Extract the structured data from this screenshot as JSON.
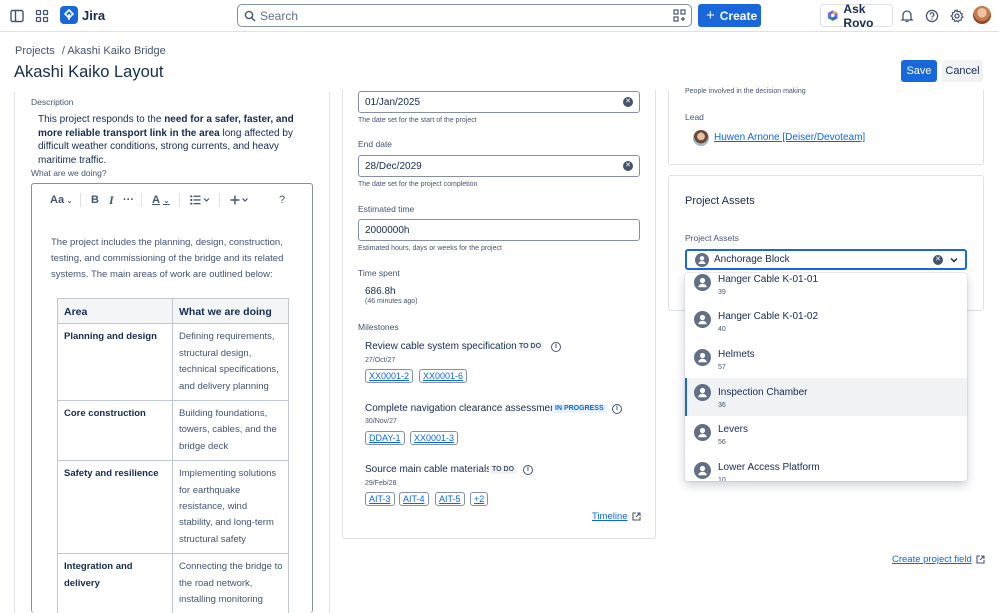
{
  "topbar": {
    "app_name": "Jira",
    "search_placeholder": "Search",
    "create_label": "Create",
    "ask_rovo_label": "Ask Rovo"
  },
  "header": {
    "breadcrumb_projects": "Projects",
    "breadcrumb_project": "/ Akashi Kaiko Bridge",
    "title": "Akashi Kaiko Layout",
    "save_label": "Save",
    "cancel_label": "Cancel"
  },
  "left": {
    "description_label": "Description",
    "description_pre": "This project responds to the ",
    "description_bold": "need for a safer, faster, and more reliable transport link in the area",
    "description_post": " long affected by difficult weather conditions, strong currents, and heavy maritime traffic.",
    "what_label": "What are we doing?",
    "toolbar": {
      "text_style": "Aa",
      "bold": "B",
      "italic": "I",
      "more": "···",
      "color": "A",
      "help": "?"
    },
    "paragraph": "The project includes the planning, design, construction, testing, and commissioning of the bridge and its related systems. The main areas of work are outlined below:",
    "table_headers": [
      "Area",
      "What we are doing"
    ],
    "table_rows": [
      {
        "area": "Planning and design",
        "doing": "Defining requirements, structural design, technical specifications, and delivery planning"
      },
      {
        "area": "Core construction",
        "doing": "Building foundations, towers, cables, and the bridge deck"
      },
      {
        "area": "Safety and resilience",
        "doing": "Implementing solutions for earthquake resistance, wind stability, and long-term structural safety"
      },
      {
        "area": "Integration and delivery",
        "doing": "Connecting the bridge to the road network, installing monitoring"
      }
    ]
  },
  "middle": {
    "start_date_value": "01/Jan/2025",
    "start_date_helper": "The date set for the start of the project",
    "end_date_label": "End date",
    "end_date_value": "28/Dec/2029",
    "end_date_helper": "The date set for the project completion",
    "estimated_label": "Estimated time",
    "estimated_value": "2000000h",
    "estimated_helper": "Estimated hours, days or weeks for the project",
    "time_spent_label": "Time spent",
    "time_spent_value": "686.8h",
    "time_spent_sub": "(46 minutes ago)",
    "milestones_label": "Milestones",
    "milestones": [
      {
        "name": "Review cable system specifications",
        "status": "TO DO",
        "date": "27/Oct/27",
        "items": [
          "XX0001-2",
          "XX0001-6"
        ]
      },
      {
        "name": "Complete navigation clearance assessment",
        "status": "IN PROGRESS",
        "date": "30/Nov/27",
        "items": [
          "DDAY-1",
          "XX0001-3"
        ]
      },
      {
        "name": "Source main cable materials",
        "status": "TO DO",
        "date": "29/Feb/28",
        "items": [
          "AIT-3",
          "AIT-4",
          "AIT-5",
          "+2"
        ]
      }
    ],
    "timeline_link": "Timeline"
  },
  "right": {
    "people_helper": "People involved in the decision making",
    "lead_label": "Lead",
    "lead_name": "Huwen Arnone [Deiser/Devoteam]",
    "assets_title": "Project Assets",
    "assets_label": "Project Assets",
    "assets_value": "Anchorage Block",
    "options": [
      {
        "name": "Hanger Cable K-01-01",
        "sub": "39"
      },
      {
        "name": "Hanger Cable K-01-02",
        "sub": "40"
      },
      {
        "name": "Helmets",
        "sub": "57"
      },
      {
        "name": "Inspection Chamber",
        "sub": "36"
      },
      {
        "name": "Levers",
        "sub": "56"
      },
      {
        "name": "Lower Access Platform",
        "sub": "10"
      }
    ],
    "create_field_link": "Create project field"
  },
  "colors": {
    "brand": "#1868db",
    "text": "#172b4d",
    "subtle": "#44546f",
    "border": "#dfe1e6"
  }
}
